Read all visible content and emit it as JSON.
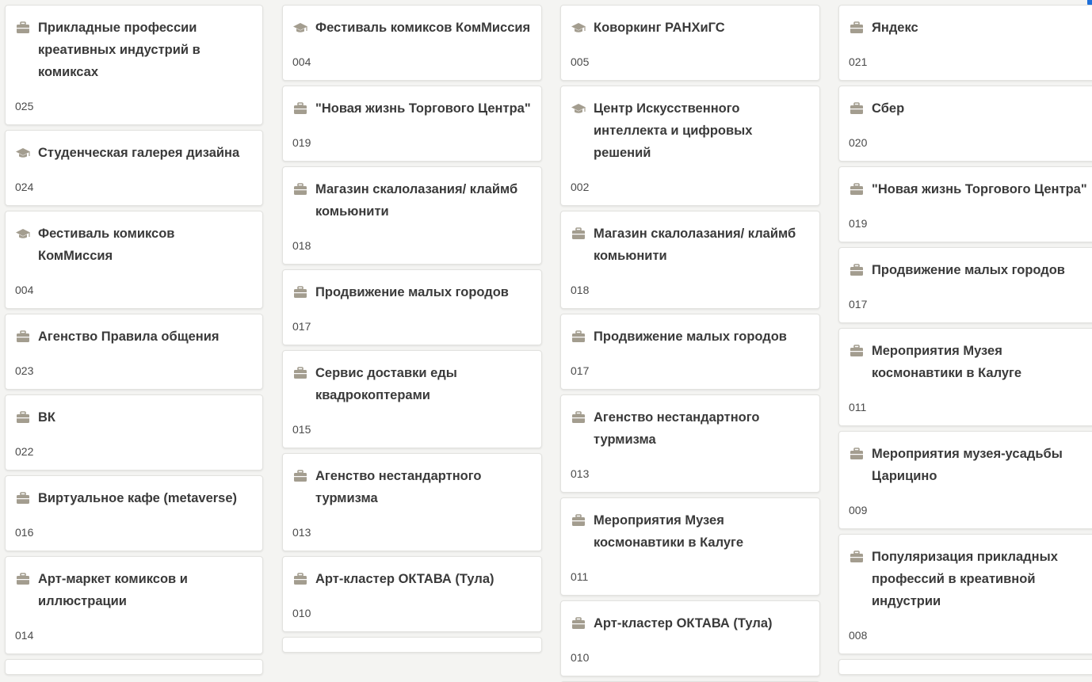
{
  "columns": [
    {
      "cards": [
        {
          "icon": "briefcase-icon",
          "title": "Прикладные профессии креативных индустрий в комиксах",
          "code": "025"
        },
        {
          "icon": "graduation-cap-icon",
          "title": "Студенческая галерея дизайна",
          "code": "024"
        },
        {
          "icon": "graduation-cap-icon",
          "title": "Фестиваль комиксов КомМиссия",
          "code": "004"
        },
        {
          "icon": "briefcase-icon",
          "title": "Агенство Правила общения",
          "code": "023"
        },
        {
          "icon": "briefcase-icon",
          "title": "ВК",
          "code": "022"
        },
        {
          "icon": "briefcase-icon",
          "title": "Виртуальное кафе (metaverse)",
          "code": "016"
        },
        {
          "icon": "briefcase-icon",
          "title": "Арт-маркет комиксов и иллюстрации",
          "code": "014"
        }
      ]
    },
    {
      "cards": [
        {
          "icon": "graduation-cap-icon",
          "title": "Фестиваль комиксов КомМиссия",
          "code": "004"
        },
        {
          "icon": "briefcase-icon",
          "title": "\"Новая жизнь Торгового Центра\"",
          "code": "019"
        },
        {
          "icon": "briefcase-icon",
          "title": "Магазин скалолазания/ клаймб комьюнити",
          "code": "018"
        },
        {
          "icon": "briefcase-icon",
          "title": "Продвижение малых городов",
          "code": "017"
        },
        {
          "icon": "briefcase-icon",
          "title": "Сервис доставки еды квадрокоптерами",
          "code": "015"
        },
        {
          "icon": "briefcase-icon",
          "title": "Агенство нестандартного турмизма",
          "code": "013"
        },
        {
          "icon": "briefcase-icon",
          "title": "Арт-кластер ОКТАВА (Тула)",
          "code": "010"
        }
      ]
    },
    {
      "cards": [
        {
          "icon": "graduation-cap-icon",
          "title": "Коворкинг РАНХиГС",
          "code": "005"
        },
        {
          "icon": "graduation-cap-icon",
          "title": "Центр Искусственного интеллекта и цифровых решений",
          "code": "002"
        },
        {
          "icon": "briefcase-icon",
          "title": "Магазин скалолазания/ клаймб комьюнити",
          "code": "018"
        },
        {
          "icon": "briefcase-icon",
          "title": "Продвижение малых городов",
          "code": "017"
        },
        {
          "icon": "briefcase-icon",
          "title": "Агенство нестандартного турмизма",
          "code": "013"
        },
        {
          "icon": "briefcase-icon",
          "title": "Мероприятия Музея космонавтики в Калуге",
          "code": "011"
        },
        {
          "icon": "briefcase-icon",
          "title": "Арт-кластер ОКТАВА (Тула)",
          "code": "010"
        }
      ]
    },
    {
      "cards": [
        {
          "icon": "briefcase-icon",
          "title": "Яндекс",
          "code": "021"
        },
        {
          "icon": "briefcase-icon",
          "title": "Сбер",
          "code": "020"
        },
        {
          "icon": "briefcase-icon",
          "title": "\"Новая жизнь Торгового Центра\"",
          "code": "019"
        },
        {
          "icon": "briefcase-icon",
          "title": "Продвижение малых городов",
          "code": "017"
        },
        {
          "icon": "briefcase-icon",
          "title": "Мероприятия Музея космонавтики в Калуге",
          "code": "011"
        },
        {
          "icon": "briefcase-icon",
          "title": "Мероприятия музея-усадьбы Царицино",
          "code": "009"
        },
        {
          "icon": "briefcase-icon",
          "title": "Популяризация прикладных профессий в креативной индустрии",
          "code": "008"
        }
      ]
    }
  ],
  "colors": {
    "icon": "#a39d8f",
    "title": "#3a3a3a",
    "code": "#4a4a4a",
    "card_bg": "#ffffff",
    "board_bg": "#f4f4f2",
    "accent": "#1e6fd9"
  }
}
